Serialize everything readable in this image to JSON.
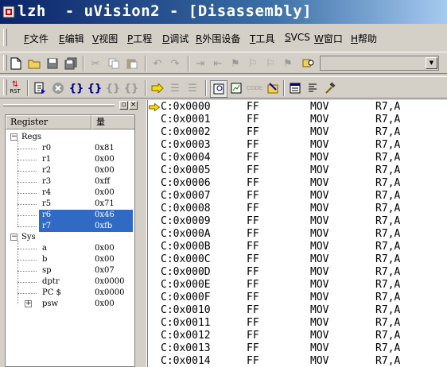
{
  "window": {
    "title": "lzh  - uVision2 - [Disassembly]"
  },
  "menu": {
    "items": [
      {
        "key": "F",
        "label": "文件"
      },
      {
        "key": "E",
        "label": "编辑"
      },
      {
        "key": "V",
        "label": "视图"
      },
      {
        "key": "P",
        "label": "工程"
      },
      {
        "key": "D",
        "label": "调试"
      },
      {
        "key": "R",
        "label": "外围设备"
      },
      {
        "key": "T",
        "label": "工具"
      },
      {
        "key": "S",
        "label": "VCS"
      },
      {
        "key": "W",
        "label": "窗口"
      },
      {
        "key": "H",
        "label": "帮助"
      }
    ]
  },
  "toolbar1": {
    "icons": [
      "new-file-icon",
      "open-folder-icon",
      "save-icon",
      "save-all-icon",
      "cut-icon",
      "copy-icon",
      "paste-icon",
      "undo-icon",
      "redo-icon",
      "indent-icon",
      "outdent-icon",
      "bookmark-toggle-icon",
      "bookmark-next-icon",
      "bookmark-prev-icon",
      "find-in-files-icon"
    ],
    "combo_value": ""
  },
  "toolbar2": {
    "rst_label": "RST",
    "icons": [
      "reset-icon",
      "run-icon",
      "stop-icon",
      "step-into-icon",
      "step-over-icon",
      "step-out-icon",
      "run-to-cursor-icon",
      "show-pc-icon",
      "breakpoint-icon",
      "watch-icon",
      "memory-icon",
      "code-coverage-icon",
      "performance-icon",
      "disassembly-icon",
      "build-icon"
    ]
  },
  "register_panel": {
    "col_register": "Register",
    "col_value": "量",
    "regs_group": "Regs",
    "sys_group": "Sys",
    "regs": [
      {
        "name": "r0",
        "value": "0x81"
      },
      {
        "name": "r1",
        "value": "0x00"
      },
      {
        "name": "r2",
        "value": "0x00"
      },
      {
        "name": "r3",
        "value": "0xff"
      },
      {
        "name": "r4",
        "value": "0x00"
      },
      {
        "name": "r5",
        "value": "0x71"
      },
      {
        "name": "r6",
        "value": "0x46"
      },
      {
        "name": "r7",
        "value": "0xfb"
      }
    ],
    "sys": [
      {
        "name": "a",
        "value": "0x00"
      },
      {
        "name": "b",
        "value": "0x00"
      },
      {
        "name": "sp",
        "value": "0x07"
      },
      {
        "name": "dptr",
        "value": "0x0000"
      },
      {
        "name": "PC  $",
        "value": "0x0000"
      },
      {
        "name": "psw",
        "value": "0x00"
      }
    ]
  },
  "disassembly": {
    "lines": [
      {
        "addr": "C:0x0000",
        "code": "FF",
        "mnemonic": "MOV",
        "operands": "R7,A"
      },
      {
        "addr": "C:0x0001",
        "code": "FF",
        "mnemonic": "MOV",
        "operands": "R7,A"
      },
      {
        "addr": "C:0x0002",
        "code": "FF",
        "mnemonic": "MOV",
        "operands": "R7,A"
      },
      {
        "addr": "C:0x0003",
        "code": "FF",
        "mnemonic": "MOV",
        "operands": "R7,A"
      },
      {
        "addr": "C:0x0004",
        "code": "FF",
        "mnemonic": "MOV",
        "operands": "R7,A"
      },
      {
        "addr": "C:0x0005",
        "code": "FF",
        "mnemonic": "MOV",
        "operands": "R7,A"
      },
      {
        "addr": "C:0x0006",
        "code": "FF",
        "mnemonic": "MOV",
        "operands": "R7,A"
      },
      {
        "addr": "C:0x0007",
        "code": "FF",
        "mnemonic": "MOV",
        "operands": "R7,A"
      },
      {
        "addr": "C:0x0008",
        "code": "FF",
        "mnemonic": "MOV",
        "operands": "R7,A"
      },
      {
        "addr": "C:0x0009",
        "code": "FF",
        "mnemonic": "MOV",
        "operands": "R7,A"
      },
      {
        "addr": "C:0x000A",
        "code": "FF",
        "mnemonic": "MOV",
        "operands": "R7,A"
      },
      {
        "addr": "C:0x000B",
        "code": "FF",
        "mnemonic": "MOV",
        "operands": "R7,A"
      },
      {
        "addr": "C:0x000C",
        "code": "FF",
        "mnemonic": "MOV",
        "operands": "R7,A"
      },
      {
        "addr": "C:0x000D",
        "code": "FF",
        "mnemonic": "MOV",
        "operands": "R7,A"
      },
      {
        "addr": "C:0x000E",
        "code": "FF",
        "mnemonic": "MOV",
        "operands": "R7,A"
      },
      {
        "addr": "C:0x000F",
        "code": "FF",
        "mnemonic": "MOV",
        "operands": "R7,A"
      },
      {
        "addr": "C:0x0010",
        "code": "FF",
        "mnemonic": "MOV",
        "operands": "R7,A"
      },
      {
        "addr": "C:0x0011",
        "code": "FF",
        "mnemonic": "MOV",
        "operands": "R7,A"
      },
      {
        "addr": "C:0x0012",
        "code": "FF",
        "mnemonic": "MOV",
        "operands": "R7,A"
      },
      {
        "addr": "C:0x0013",
        "code": "FF",
        "mnemonic": "MOV",
        "operands": "R7,A"
      },
      {
        "addr": "C:0x0014",
        "code": "FF",
        "mnemonic": "MOV",
        "operands": "R7,A"
      }
    ]
  }
}
